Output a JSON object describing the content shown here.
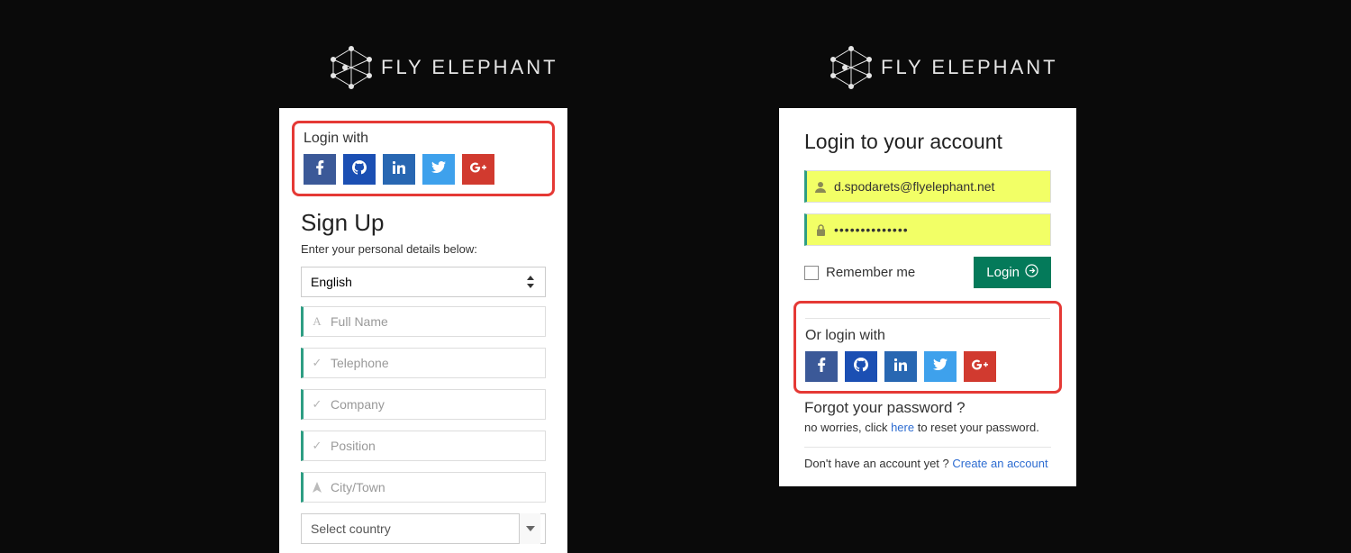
{
  "brand": {
    "name": "FLY ELEPHANT"
  },
  "left": {
    "loginWithLabel": "Login with",
    "signUpTitle": "Sign Up",
    "signUpSub": "Enter your personal details below:",
    "languageSelected": "English",
    "fields": {
      "fullName": "Full Name",
      "telephone": "Telephone",
      "company": "Company",
      "position": "Position",
      "city": "City/Town",
      "country": "Select country"
    }
  },
  "right": {
    "title": "Login to your account",
    "emailValue": "d.spodarets@flyelephant.net",
    "passwordMasked": "••••••••••••••",
    "rememberLabel": "Remember me",
    "loginButton": "Login",
    "orLoginWith": "Or login with",
    "forgotTitle": "Forgot your password ?",
    "forgotTextPre": "no worries, click ",
    "forgotLink": "here",
    "forgotTextPost": " to reset your password.",
    "noAccountPre": "Don't have an account yet ?  ",
    "createAccount": "Create an account"
  },
  "social": {
    "facebook": "facebook",
    "github": "github",
    "linkedin": "linkedin",
    "twitter": "twitter",
    "googleplus": "google-plus"
  }
}
